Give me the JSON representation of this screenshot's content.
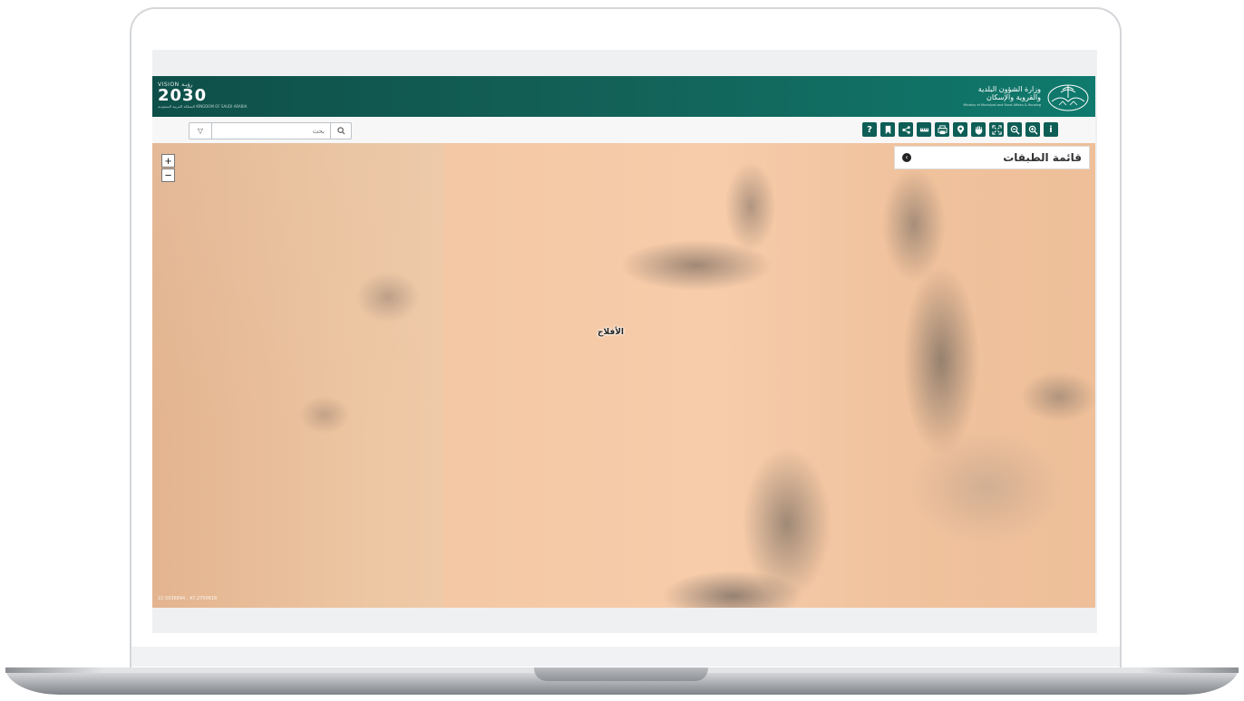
{
  "header": {
    "vision_small": "VISION رؤيـة",
    "vision_year": "2030",
    "vision_country": "المملكة العربية السعودية KINGDOM OF SAUDI ARABIA",
    "ministry_line1": "وزارة الشؤون البلدية",
    "ministry_line2": "والقروية والإسكان",
    "ministry_sub": "Ministry of Municipal and Rural Affairs & Housing"
  },
  "search": {
    "placeholder": "بحث"
  },
  "tools": [
    {
      "name": "help",
      "label": "?"
    },
    {
      "name": "bookmark"
    },
    {
      "name": "share"
    },
    {
      "name": "measure"
    },
    {
      "name": "print"
    },
    {
      "name": "location"
    },
    {
      "name": "pan"
    },
    {
      "name": "fullscreen"
    },
    {
      "name": "zoom-out"
    },
    {
      "name": "zoom-in"
    },
    {
      "name": "info",
      "label": "i"
    }
  ],
  "map": {
    "zoom_in": "+",
    "zoom_out": "−",
    "place_label": "الأفلاج",
    "coordinates": "22.5936894 , 47.2750618",
    "layers_title": "قائمة الطبقات"
  },
  "colors": {
    "header_start": "#0e4f49",
    "header_end": "#0f7a6d",
    "tool_bg": "#0d5e56"
  }
}
